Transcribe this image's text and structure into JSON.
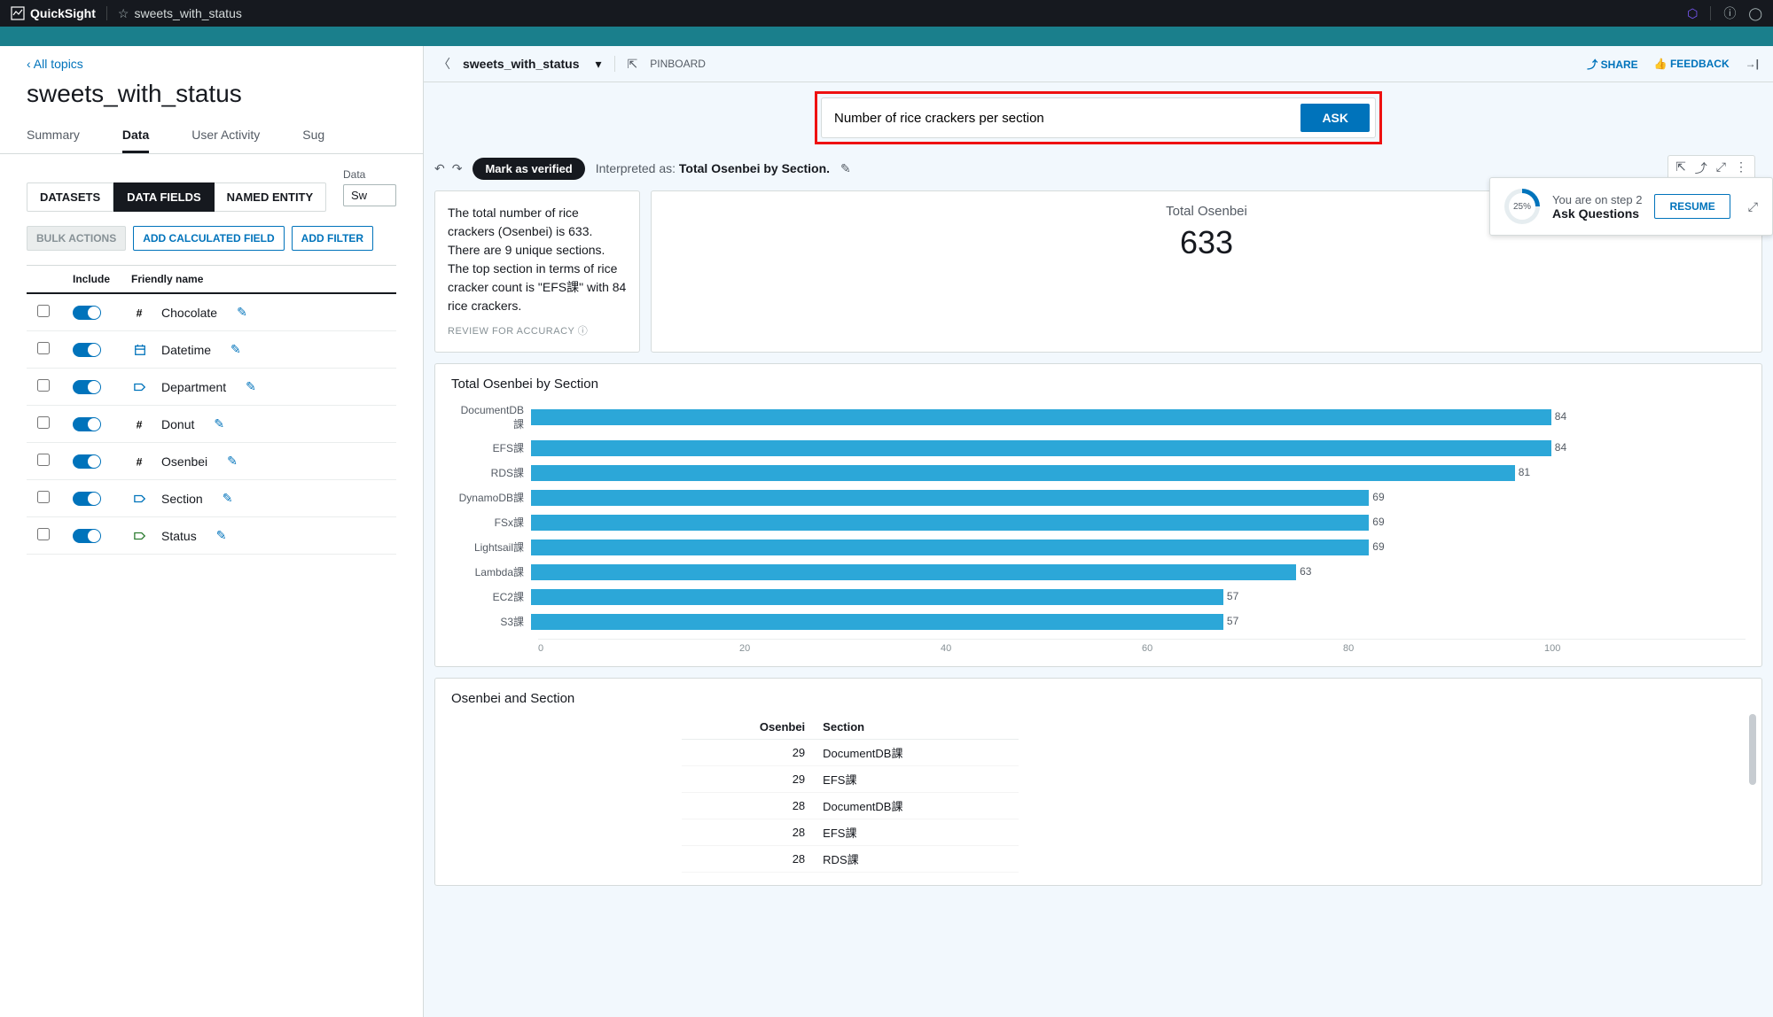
{
  "topbar": {
    "product": "QuickSight",
    "doc_title": "sweets_with_status"
  },
  "left": {
    "back_label": "All topics",
    "title": "sweets_with_status",
    "tabs": [
      "Summary",
      "Data",
      "User Activity",
      "Sug"
    ],
    "active_tab": "Data",
    "dataset_label": "Data",
    "dataset_value": "Sw",
    "subtabs": [
      "DATASETS",
      "DATA FIELDS",
      "NAMED ENTITY"
    ],
    "active_subtab": "DATA FIELDS",
    "bulk_actions": "BULK ACTIONS",
    "add_calc": "ADD CALCULATED FIELD",
    "add_filter": "ADD FILTER",
    "col_include": "Include",
    "col_friendly": "Friendly name",
    "fields": [
      {
        "name": "Chocolate",
        "icon": "hash",
        "color": "#2e7d32"
      },
      {
        "name": "Datetime",
        "icon": "calendar",
        "color": "#0073bb"
      },
      {
        "name": "Department",
        "icon": "tag",
        "color": "#0073bb"
      },
      {
        "name": "Donut",
        "icon": "hash",
        "color": "#2e7d32"
      },
      {
        "name": "Osenbei",
        "icon": "hash",
        "color": "#2e7d32"
      },
      {
        "name": "Section",
        "icon": "tag",
        "color": "#0073bb"
      },
      {
        "name": "Status",
        "icon": "tag",
        "color": "#2e7d32"
      }
    ]
  },
  "right": {
    "title": "sweets_with_status",
    "pinboard": "PINBOARD",
    "share": "SHARE",
    "feedback": "FEEDBACK",
    "ask_value": "Number of rice crackers per section",
    "ask_button": "ASK",
    "mark_verified": "Mark as verified",
    "interpreted_prefix": "Interpreted as: ",
    "interpreted_bold": "Total Osenbei by Section.",
    "summary_text": "The total number of rice crackers (Osenbei) is 633. There are 9 unique sections. The top section in terms of rice cracker count is \"EFS課\" with 84 rice crackers.",
    "review": "REVIEW FOR ACCURACY",
    "kpi_label": "Total Osenbei",
    "kpi_value": "633",
    "step_line1": "You are on step 2",
    "step_line2": "Ask Questions",
    "resume": "RESUME",
    "chart_title": "Total Osenbei by Section",
    "table_title": "Osenbei and Section",
    "table_col1": "Osenbei",
    "table_col2": "Section",
    "table_rows": [
      {
        "v": 29,
        "s": "DocumentDB課"
      },
      {
        "v": 29,
        "s": "EFS課"
      },
      {
        "v": 28,
        "s": "DocumentDB課"
      },
      {
        "v": 28,
        "s": "EFS課"
      },
      {
        "v": 28,
        "s": "RDS課"
      }
    ],
    "axis_ticks": [
      "0",
      "20",
      "40",
      "60",
      "80",
      "100"
    ]
  },
  "chart_data": {
    "type": "bar",
    "orientation": "horizontal",
    "title": "Total Osenbei by Section",
    "xlabel": "",
    "ylabel": "",
    "xlim": [
      0,
      100
    ],
    "categories": [
      "DocumentDB課",
      "EFS課",
      "RDS課",
      "DynamoDB課",
      "FSx課",
      "Lightsail課",
      "Lambda課",
      "EC2課",
      "S3課"
    ],
    "values": [
      84,
      84,
      81,
      69,
      69,
      69,
      63,
      57,
      57
    ]
  }
}
